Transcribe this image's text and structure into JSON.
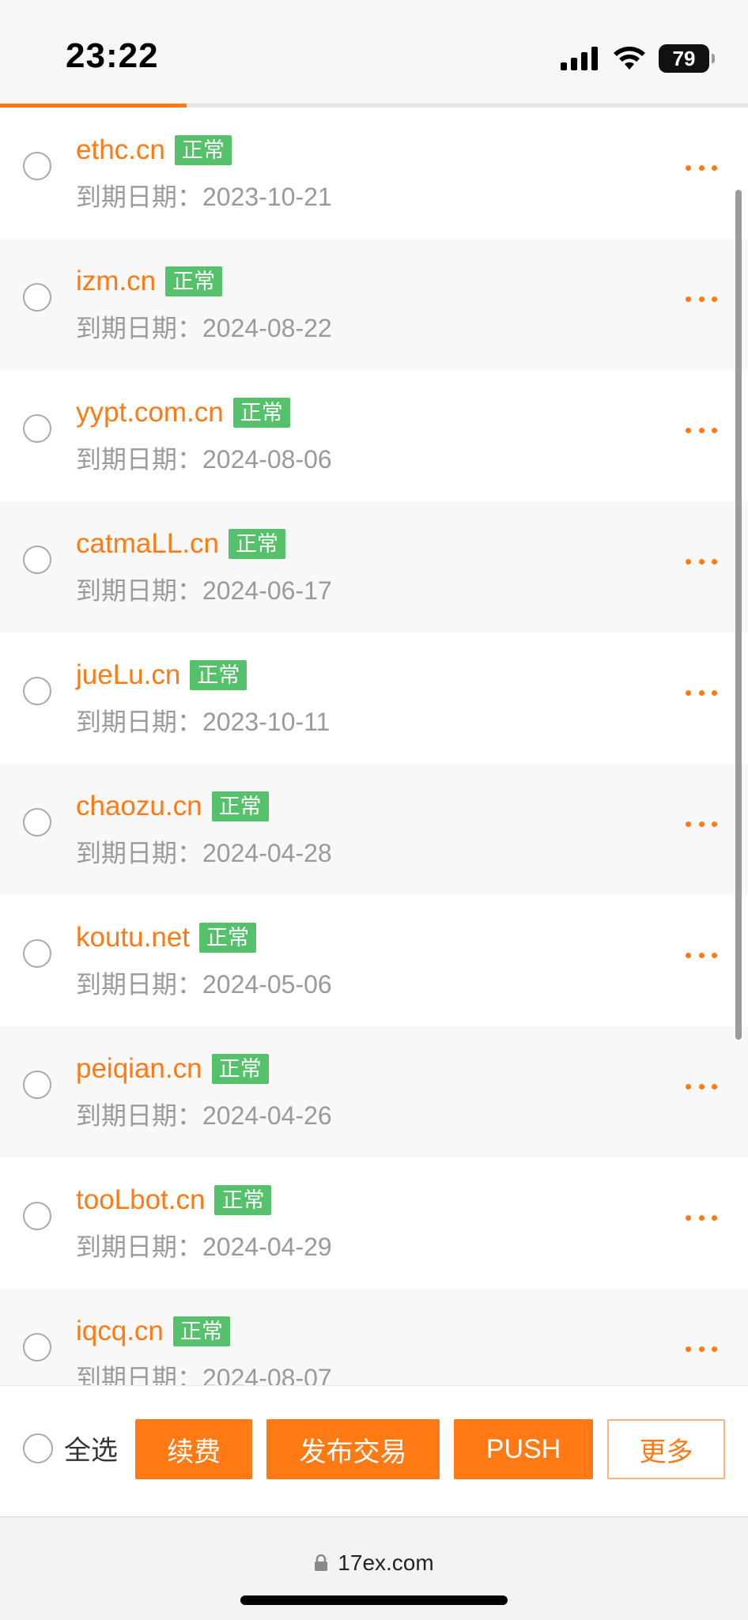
{
  "status_bar": {
    "time": "23:22",
    "battery": "79"
  },
  "domains": [
    {
      "name": "ethc.cn",
      "status": "正常",
      "expiry": "到期日期：2023-10-21"
    },
    {
      "name": "izm.cn",
      "status": "正常",
      "expiry": "到期日期：2024-08-22"
    },
    {
      "name": "yypt.com.cn",
      "status": "正常",
      "expiry": "到期日期：2024-08-06"
    },
    {
      "name": "catmaLL.cn",
      "status": "正常",
      "expiry": "到期日期：2024-06-17"
    },
    {
      "name": "jueLu.cn",
      "status": "正常",
      "expiry": "到期日期：2023-10-11"
    },
    {
      "name": "chaozu.cn",
      "status": "正常",
      "expiry": "到期日期：2024-04-28"
    },
    {
      "name": "koutu.net",
      "status": "正常",
      "expiry": "到期日期：2024-05-06"
    },
    {
      "name": "peiqian.cn",
      "status": "正常",
      "expiry": "到期日期：2024-04-26"
    },
    {
      "name": "tooLbot.cn",
      "status": "正常",
      "expiry": "到期日期：2024-04-29"
    },
    {
      "name": "iqcq.cn",
      "status": "正常",
      "expiry": "到期日期：2024-08-07"
    }
  ],
  "bottom_bar": {
    "select_all": "全选",
    "renew": "续费",
    "publish_trade": "发布交易",
    "push": "PUSH",
    "more": "更多"
  },
  "browser": {
    "url": "17ex.com"
  },
  "colors": {
    "accent": "#ff7a14",
    "status_normal": "#55c16b"
  }
}
